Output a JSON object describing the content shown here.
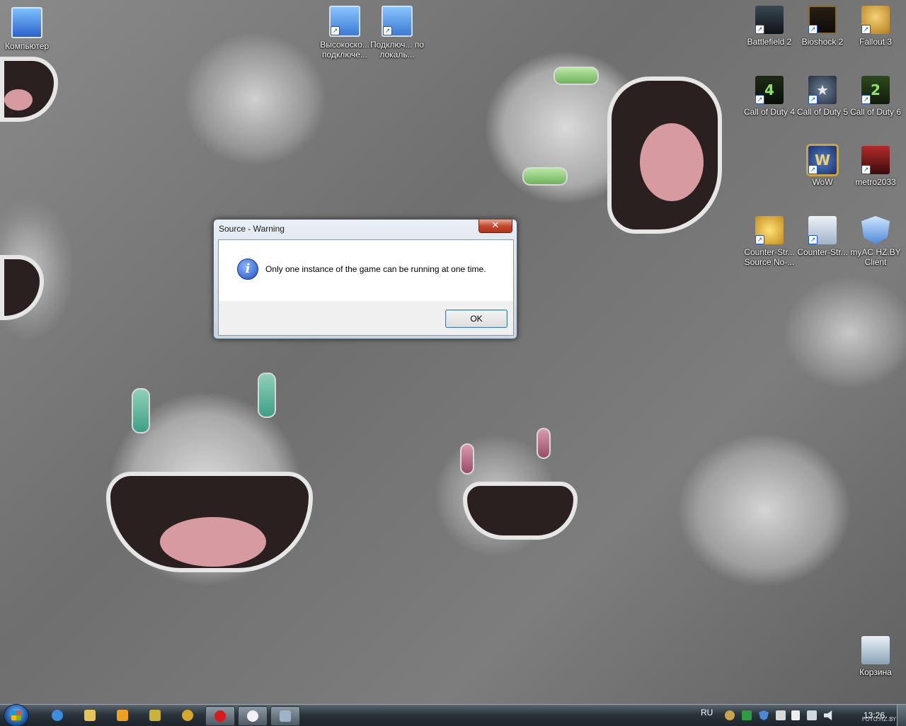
{
  "desktop": {
    "icons": [
      {
        "label": "Компьютер",
        "icon": "computer-icon",
        "shortcut": false
      },
      {
        "label": "Высокоско... подключе...",
        "icon": "network-connection-icon",
        "shortcut": true
      },
      {
        "label": "Подключ... по локаль...",
        "icon": "lan-connection-icon",
        "shortcut": true
      },
      {
        "label": "Battlefield 2",
        "icon": "battlefield2-icon",
        "shortcut": true
      },
      {
        "label": "Bioshock 2",
        "icon": "bioshock2-icon",
        "shortcut": true
      },
      {
        "label": "Fallout 3",
        "icon": "fallout3-icon",
        "shortcut": true
      },
      {
        "label": "Call of Duty 4",
        "icon": "cod4-icon",
        "glyph": "4",
        "shortcut": true
      },
      {
        "label": "Call of Duty 5",
        "icon": "cod5-icon",
        "shortcut": true
      },
      {
        "label": "Call of Duty 6",
        "icon": "cod6-icon",
        "glyph": "2",
        "shortcut": true
      },
      {
        "label": "WoW",
        "icon": "wow-icon",
        "glyph": "W",
        "shortcut": true
      },
      {
        "label": "metro2033",
        "icon": "metro2033-icon",
        "shortcut": true
      },
      {
        "label": "Counter-Str... Source No-...",
        "icon": "counter-strike-source-icon",
        "shortcut": true
      },
      {
        "label": "Counter-Str...",
        "icon": "counter-strike-icon",
        "shortcut": true
      },
      {
        "label": "myAC HZ.BY Client",
        "icon": "myac-client-icon",
        "shortcut": true
      },
      {
        "label": "Корзина",
        "icon": "recycle-bin-icon",
        "shortcut": false
      }
    ]
  },
  "dialog": {
    "title": "Source - Warning",
    "close_label": "✕",
    "message": "Only one instance of the game can be running at one time.",
    "icon": "info-icon",
    "icon_glyph": "i",
    "ok_label": "OK"
  },
  "taskbar": {
    "start": "start-button",
    "pinned": [
      {
        "icon": "internet-explorer-icon",
        "color": "#3b8de0"
      },
      {
        "icon": "explorer-folder-icon",
        "color": "#e7c35b"
      },
      {
        "icon": "media-player-icon",
        "color": "#f0a020"
      },
      {
        "icon": "app-icon-1",
        "color": "#c9b23a"
      },
      {
        "icon": "app-icon-2",
        "color": "#d8a82a"
      },
      {
        "icon": "opera-icon",
        "color": "#d8191e"
      },
      {
        "icon": "counter-strike-taskbar-icon",
        "color": "#f2f2f2"
      },
      {
        "icon": "app-icon-3",
        "color": "#9fb4c8"
      }
    ],
    "tray": {
      "language": "RU",
      "icons": [
        "tray-icon-1",
        "tray-icon-2",
        "shield-icon",
        "no-network-icon",
        "flag-icon",
        "network-icon",
        "volume-icon"
      ],
      "clock": "13:26"
    }
  },
  "watermark": "FOTO.HZ.BY"
}
